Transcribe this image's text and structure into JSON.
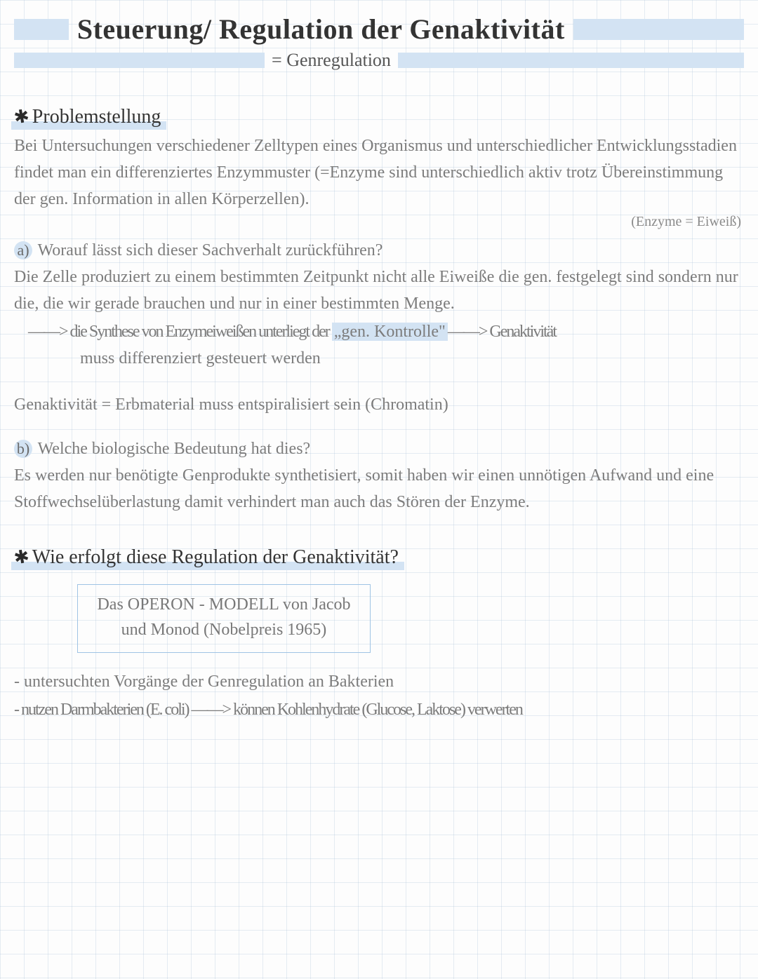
{
  "header": {
    "title": "Steuerung/ Regulation der Genaktivität",
    "subtitle": "= Genregulation"
  },
  "section_problem": {
    "heading": "Problemstellung",
    "intro": "Bei Untersuchungen verschiedener Zelltypen eines Organismus und unterschiedlicher Entwicklungsstadien findet man ein differenziertes Enzymmuster (=Enzyme sind unterschiedlich aktiv trotz Übereinstimmung der gen. Information in allen Körperzellen).",
    "paren": "(Enzyme = Eiweiß)",
    "qa_label": "a)",
    "qa_text": "Worauf lässt sich dieser Sachverhalt zurückführen?",
    "qa_answer": "Die Zelle produziert zu einem bestimmten Zeitpunkt nicht alle Eiweiße die gen. festgelegt sind sondern nur die, die wir gerade brauchen und nur in einer bestimmten Menge.",
    "arrow_pre": "——> die Synthese von Enzymeiweißen unterliegt der ",
    "arrow_hl": "„gen. Kontrolle\"",
    "arrow_post": "——>  Genaktivität",
    "arrow_line2": "muss differenziert gesteuert werden",
    "genaktiv": "Genaktivität = Erbmaterial muss entspiralisiert sein (Chromatin)",
    "qb_label": "b)",
    "qb_text": "Welche biologische Bedeutung hat dies?",
    "qb_answer": "Es werden nur benötigte Genprodukte synthetisiert, somit haben wir einen unnötigen Aufwand und eine Stoffwechselüberlastung damit verhindert man auch das Stören der Enzyme."
  },
  "section_regulation": {
    "heading": "Wie erfolgt diese Regulation der Genaktivität?",
    "box_line1": "Das OPERON - MODELL  von Jacob",
    "box_line2": "und Monod (Nobelpreis 1965)",
    "bullet1": "- untersuchten Vorgänge der Genregulation an Bakterien",
    "bullet2": "- nutzen Darmbakterien (E. coli) ——> können Kohlenhydrate (Glucose, Laktose) verwerten"
  }
}
